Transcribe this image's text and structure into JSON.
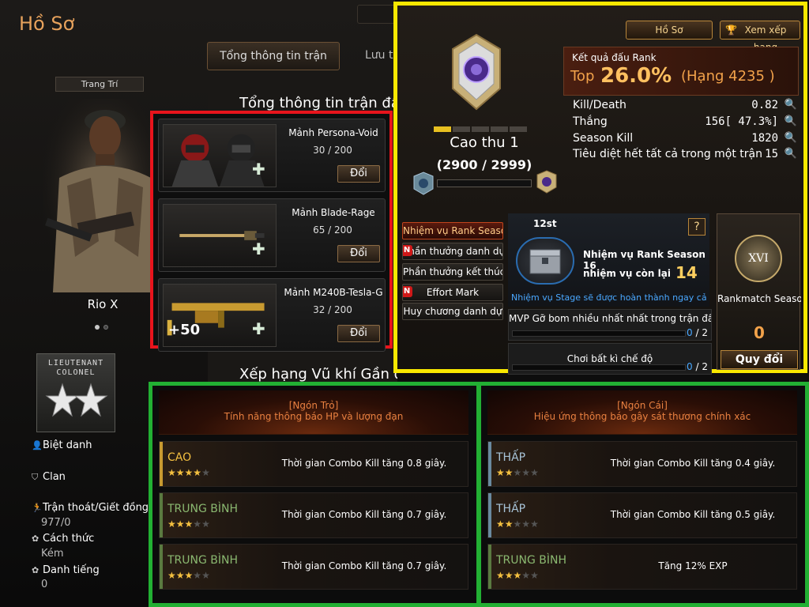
{
  "header": {
    "title": "Hồ Sơ",
    "tab_overview": "Tổng thông tin trận đấu",
    "tab_history": "Lưu t"
  },
  "profile": {
    "decor_label": "Trang Trí",
    "character_name": "Rio X",
    "rank_badge_line1": "LIEUTENANT",
    "rank_badge_line2": "COLONEL",
    "nickname_label": "Biệt danh",
    "clan_label": "Clan",
    "escape_label": "Trận thoát/Giết đồng đội",
    "escape_value": "977/0",
    "manner_label": "Cách thức",
    "manner_value": "Kém",
    "reputation_label": "Danh tiếng",
    "reputation_value": "0"
  },
  "sections": {
    "overview_title": "Tổng thông tin trận đấu",
    "weapon_ranking_title": "Xếp hạng Vũ khí Gần đây"
  },
  "fragments": [
    {
      "name": "Mảnh Persona-Void",
      "count": "30 / 200",
      "button": "Đổi",
      "bonus": ""
    },
    {
      "name": "Mảnh Blade-Rage",
      "count": "65 / 200",
      "button": "Đổi",
      "bonus": ""
    },
    {
      "name": "Mảnh M240B-Tesla-G",
      "count": "32 / 200",
      "button": "Đổi",
      "bonus": "+50"
    }
  ],
  "rank": {
    "profile_button": "Hồ Sơ",
    "leaderboard_button": "Xem xếp hạng",
    "title": "Cao thu 1",
    "points": "(2900 / 2999)",
    "progress_segments_filled": 1,
    "progress_segments_total": 5,
    "result_label": "Kết quả đấu Rank",
    "top_label": "Top",
    "top_percent": "26.0%",
    "rank_text": "(Hạng   4235 )",
    "stats": [
      {
        "label": "Kill/Death",
        "value": "0.82"
      },
      {
        "label": "Thắng",
        "value": "156[ 47.3%]"
      },
      {
        "label": "Season Kill",
        "value": "1820"
      },
      {
        "label": "Tiêu diệt hết tất cả trong một trận",
        "value": "15"
      }
    ]
  },
  "menu": [
    {
      "label": "Nhiệm vụ Rank Season",
      "active": true,
      "new": false
    },
    {
      "label": "Phần thưởng danh dự",
      "active": false,
      "new": true
    },
    {
      "label": "Phần thưởng kết thúc",
      "active": false,
      "new": false
    },
    {
      "label": "Effort Mark",
      "active": false,
      "new": true
    },
    {
      "label": "Huy chương danh dự",
      "active": false,
      "new": false
    }
  ],
  "mission": {
    "round": "12st",
    "help": "?",
    "title": "Nhiệm vụ Rank Season 16",
    "remain_label": "nhiệm vụ còn lại",
    "remain_count": "14",
    "note": "Nhiệm vụ Stage sẽ được hoàn thành ngay cả",
    "tasks": [
      {
        "label": "MVP Gỡ bom nhiều nhất nhất trong trận đấu",
        "current": "0",
        "total": " / 2"
      },
      {
        "label": "Chơi bất kì chế độ",
        "current": "0",
        "total": " / 2"
      }
    ]
  },
  "rankmatch": {
    "coin_text": "XVI",
    "label": "Rankmatch Season",
    "value": "0",
    "button": "Quy đổi"
  },
  "effects": [
    {
      "title": "[Ngón Trỏ]",
      "desc": "Tính năng thông báo HP và lượng đạn",
      "rows": [
        {
          "level": "CAO",
          "stars": 4,
          "text": "Thời gian Combo Kill tăng 0.8 giây.",
          "tier": "high",
          "color": "#f4c040"
        },
        {
          "level": "TRUNG BÌNH",
          "stars": 3,
          "text": "Thời gian Combo Kill tăng 0.7 giây.",
          "tier": "mid",
          "color": "#8ab870"
        },
        {
          "level": "TRUNG BÌNH",
          "stars": 3,
          "text": "Thời gian Combo Kill tăng 0.7 giây.",
          "tier": "mid",
          "color": "#8ab870"
        }
      ]
    },
    {
      "title": "[Ngón Cái]",
      "desc": "Hiệu ứng thông báo gây sát thương chính xác",
      "rows": [
        {
          "level": "THẤP",
          "stars": 2,
          "text": "Thời gian Combo Kill tăng 0.4 giây.",
          "tier": "low",
          "color": "#a8c4d8"
        },
        {
          "level": "THẤP",
          "stars": 2,
          "text": "Thời gian Combo Kill tăng 0.5 giây.",
          "tier": "low",
          "color": "#a8c4d8"
        },
        {
          "level": "TRUNG BÌNH",
          "stars": 3,
          "text": "Tăng 12% EXP",
          "tier": "mid",
          "color": "#8ab870"
        }
      ]
    }
  ],
  "colors": {
    "highlight_red": "#e8141c",
    "highlight_yellow": "#f8e800",
    "highlight_green": "#22b033",
    "accent_orange": "#e7a25c"
  }
}
